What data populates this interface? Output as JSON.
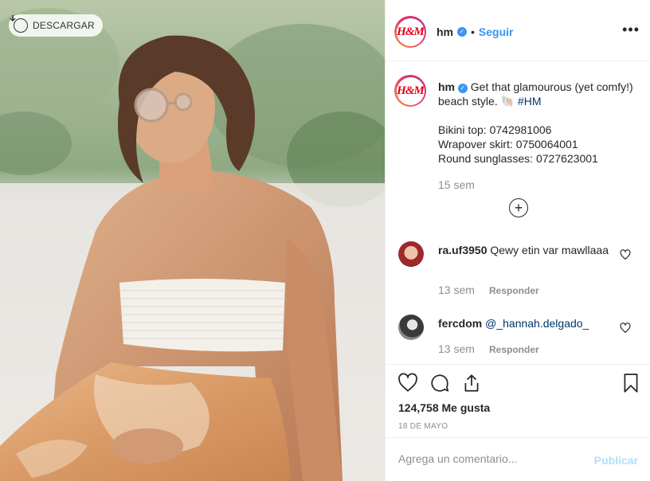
{
  "photo": {
    "download_label": "DESCARGAR",
    "download_icon": "download-circle-icon"
  },
  "header": {
    "username": "hm",
    "avatar_text": "H&M",
    "verified_icon": "verified-badge-icon",
    "separator": "•",
    "follow_label": "Seguir",
    "more_label": "•••"
  },
  "caption": {
    "username": "hm",
    "text_before_tag": "Get that glamourous (yet comfy!) beach style. 🐚",
    "hashtag": "#HM",
    "items": [
      "Bikini top: 0742981006",
      "Wrapover skirt: 0750064001",
      "Round sunglasses: 0727623001"
    ],
    "time": "15 sem",
    "load_more_label": "+"
  },
  "comments": [
    {
      "username": "ra.uf3950",
      "text": "Qewy etin var mawllaaa",
      "time": "13 sem",
      "reply_label": "Responder"
    },
    {
      "username": "fercdom",
      "text": "@_hannah.delgado_",
      "time": "13 sem",
      "reply_label": "Responder"
    }
  ],
  "actions": {
    "likes": "124,758 Me gusta",
    "date": "18 DE MAYO"
  },
  "add_comment": {
    "placeholder": "Agrega un comentario...",
    "publish_label": "Publicar"
  },
  "colors": {
    "accent": "#3897f0",
    "hashtag": "#003569",
    "muted": "#8e8e8e",
    "publish_disabled": "#b2dffc",
    "brand_red": "#e0001b"
  }
}
